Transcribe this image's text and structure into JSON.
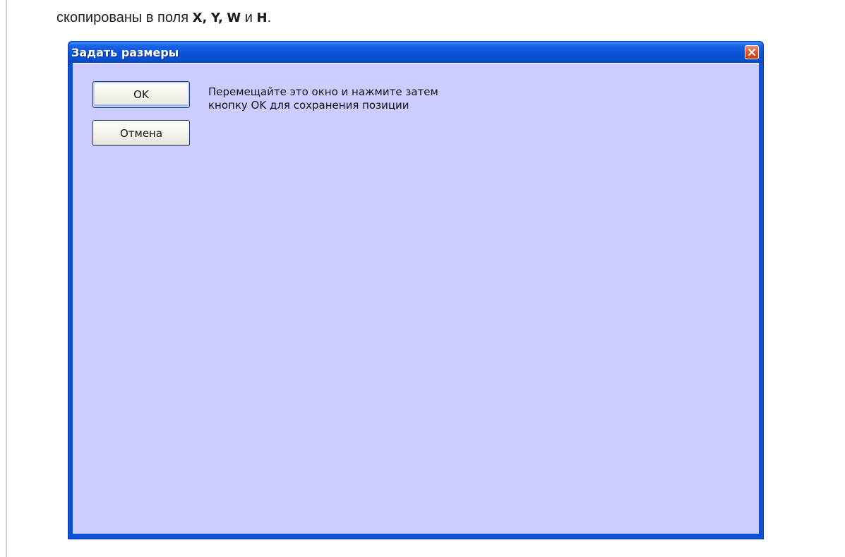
{
  "caption": {
    "text_before": "скопированы в поля",
    "field_x": "X,",
    "field_y": "Y,",
    "field_w": "W",
    "conj": "и",
    "field_h": "H",
    "period": "."
  },
  "dialog": {
    "title": "Задать размеры",
    "ok_label": "OK",
    "cancel_label": "Отмена",
    "message_line1": "Перемещайте это окно и нажмите затем",
    "message_line2": "кнопку OK для сохранения позиции"
  },
  "colors": {
    "titlebar": "#0a54d8",
    "client_background": "#ccccfe",
    "close_button": "#e0552e"
  },
  "icons": {
    "close": "close-x-icon"
  }
}
